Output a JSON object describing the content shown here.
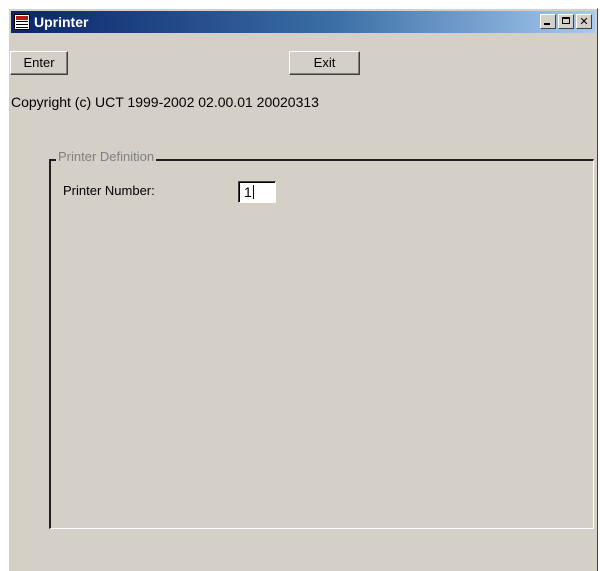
{
  "window": {
    "title": "Uprinter",
    "icon": "app-icon",
    "caption_buttons": [
      "minimize",
      "maximize",
      "close"
    ]
  },
  "toolbar": {
    "enter_label": "Enter",
    "exit_label": "Exit"
  },
  "copyright": "Copyright (c) UCT 1999-2002 02.00.01 20020313",
  "printer_definition": {
    "legend": "Printer Definition",
    "printer_number_label": "Printer Number:",
    "printer_number_value": "1"
  },
  "colors": {
    "title_gradient_start": "#0a246a",
    "title_gradient_end": "#a6caf0",
    "face": "#d4d0c8"
  }
}
